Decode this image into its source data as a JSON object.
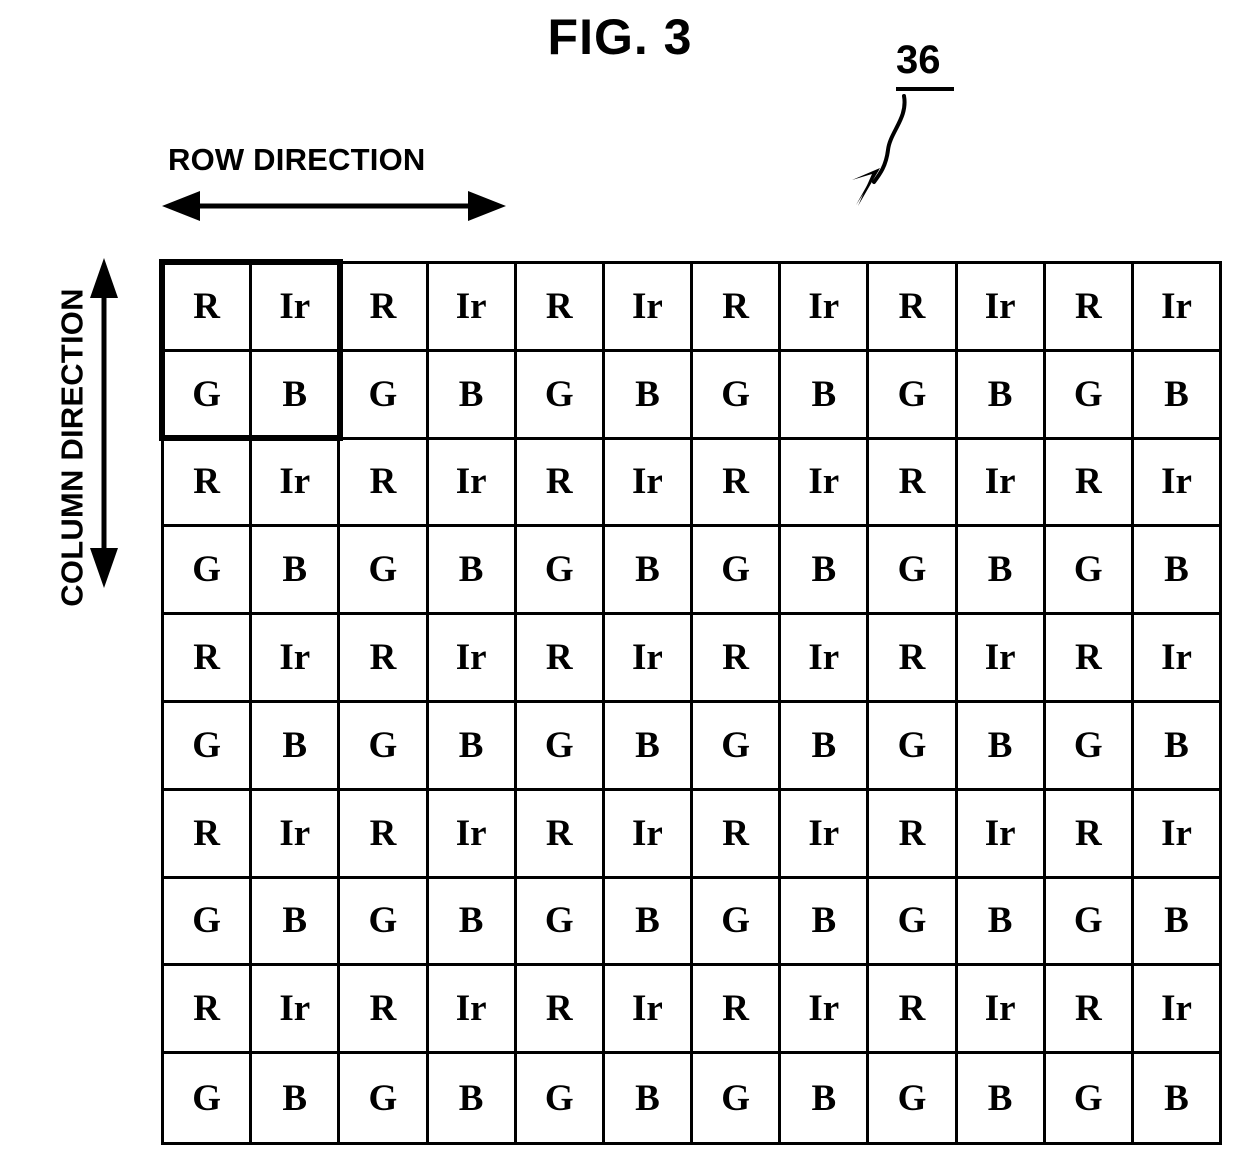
{
  "figure": {
    "title": "FIG. 3",
    "reference_numeral": "36"
  },
  "axes": {
    "row_direction_label": "ROW DIRECTION",
    "column_direction_label": "COLUMN DIRECTION"
  },
  "colors": {
    "ink": "#000000",
    "background": "#ffffff"
  },
  "grid": {
    "columns": 12,
    "rows": 10,
    "unit_cell": {
      "rows": 2,
      "columns": 2,
      "labels": [
        [
          "R",
          "Ir"
        ],
        [
          "G",
          "B"
        ]
      ]
    },
    "cells": [
      [
        "R",
        "Ir",
        "R",
        "Ir",
        "R",
        "Ir",
        "R",
        "Ir",
        "R",
        "Ir",
        "R",
        "Ir"
      ],
      [
        "G",
        "B",
        "G",
        "B",
        "G",
        "B",
        "G",
        "B",
        "G",
        "B",
        "G",
        "B"
      ],
      [
        "R",
        "Ir",
        "R",
        "Ir",
        "R",
        "Ir",
        "R",
        "Ir",
        "R",
        "Ir",
        "R",
        "Ir"
      ],
      [
        "G",
        "B",
        "G",
        "B",
        "G",
        "B",
        "G",
        "B",
        "G",
        "B",
        "G",
        "B"
      ],
      [
        "R",
        "Ir",
        "R",
        "Ir",
        "R",
        "Ir",
        "R",
        "Ir",
        "R",
        "Ir",
        "R",
        "Ir"
      ],
      [
        "G",
        "B",
        "G",
        "B",
        "G",
        "B",
        "G",
        "B",
        "G",
        "B",
        "G",
        "B"
      ],
      [
        "R",
        "Ir",
        "R",
        "Ir",
        "R",
        "Ir",
        "R",
        "Ir",
        "R",
        "Ir",
        "R",
        "Ir"
      ],
      [
        "G",
        "B",
        "G",
        "B",
        "G",
        "B",
        "G",
        "B",
        "G",
        "B",
        "G",
        "B"
      ],
      [
        "R",
        "Ir",
        "R",
        "Ir",
        "R",
        "Ir",
        "R",
        "Ir",
        "R",
        "Ir",
        "R",
        "Ir"
      ],
      [
        "G",
        "B",
        "G",
        "B",
        "G",
        "B",
        "G",
        "B",
        "G",
        "B",
        "G",
        "B"
      ]
    ]
  }
}
